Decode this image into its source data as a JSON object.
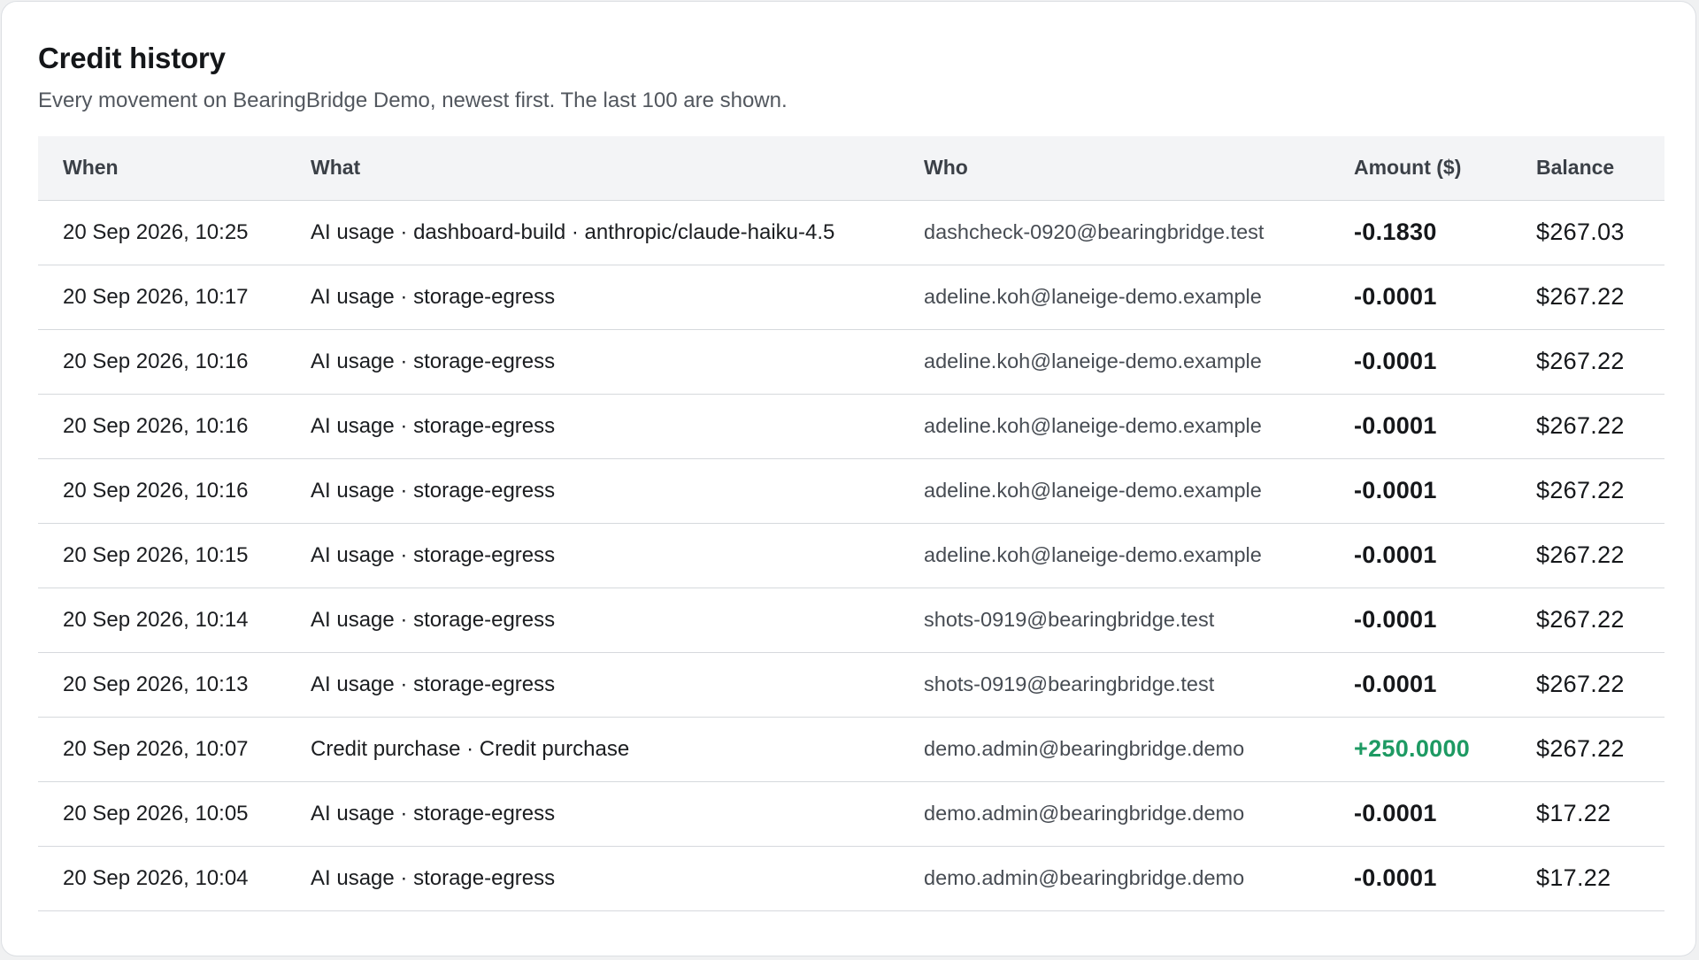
{
  "panel": {
    "title": "Credit history",
    "subtitle": "Every movement on BearingBridge Demo, newest first. The last 100 are shown."
  },
  "table": {
    "columns": [
      "When",
      "What",
      "Who",
      "Amount ($)",
      "Balance"
    ],
    "rows": [
      {
        "when": "20 Sep 2026, 10:25",
        "what": "AI usage · dashboard-build · anthropic/claude-haiku-4.5",
        "who": "dashcheck-0920@bearingbridge.test",
        "amount": "-0.1830",
        "balance": "$267.03"
      },
      {
        "when": "20 Sep 2026, 10:17",
        "what": "AI usage · storage-egress",
        "who": "adeline.koh@laneige-demo.example",
        "amount": "-0.0001",
        "balance": "$267.22"
      },
      {
        "when": "20 Sep 2026, 10:16",
        "what": "AI usage · storage-egress",
        "who": "adeline.koh@laneige-demo.example",
        "amount": "-0.0001",
        "balance": "$267.22"
      },
      {
        "when": "20 Sep 2026, 10:16",
        "what": "AI usage · storage-egress",
        "who": "adeline.koh@laneige-demo.example",
        "amount": "-0.0001",
        "balance": "$267.22"
      },
      {
        "when": "20 Sep 2026, 10:16",
        "what": "AI usage · storage-egress",
        "who": "adeline.koh@laneige-demo.example",
        "amount": "-0.0001",
        "balance": "$267.22"
      },
      {
        "when": "20 Sep 2026, 10:15",
        "what": "AI usage · storage-egress",
        "who": "adeline.koh@laneige-demo.example",
        "amount": "-0.0001",
        "balance": "$267.22"
      },
      {
        "when": "20 Sep 2026, 10:14",
        "what": "AI usage · storage-egress",
        "who": "shots-0919@bearingbridge.test",
        "amount": "-0.0001",
        "balance": "$267.22"
      },
      {
        "when": "20 Sep 2026, 10:13",
        "what": "AI usage · storage-egress",
        "who": "shots-0919@bearingbridge.test",
        "amount": "-0.0001",
        "balance": "$267.22"
      },
      {
        "when": "20 Sep 2026, 10:07",
        "what": "Credit purchase · Credit purchase",
        "who": "demo.admin@bearingbridge.demo",
        "amount": "+250.0000",
        "balance": "$267.22",
        "positive": true
      },
      {
        "when": "20 Sep 2026, 10:05",
        "what": "AI usage · storage-egress",
        "who": "demo.admin@bearingbridge.demo",
        "amount": "-0.0001",
        "balance": "$17.22"
      },
      {
        "when": "20 Sep 2026, 10:04",
        "what": "AI usage · storage-egress",
        "who": "demo.admin@bearingbridge.demo",
        "amount": "-0.0001",
        "balance": "$17.22"
      }
    ]
  },
  "colors": {
    "positive_amount": "#1e9a63",
    "header_background": "#f3f4f6",
    "row_divider": "#d6d9dd"
  }
}
